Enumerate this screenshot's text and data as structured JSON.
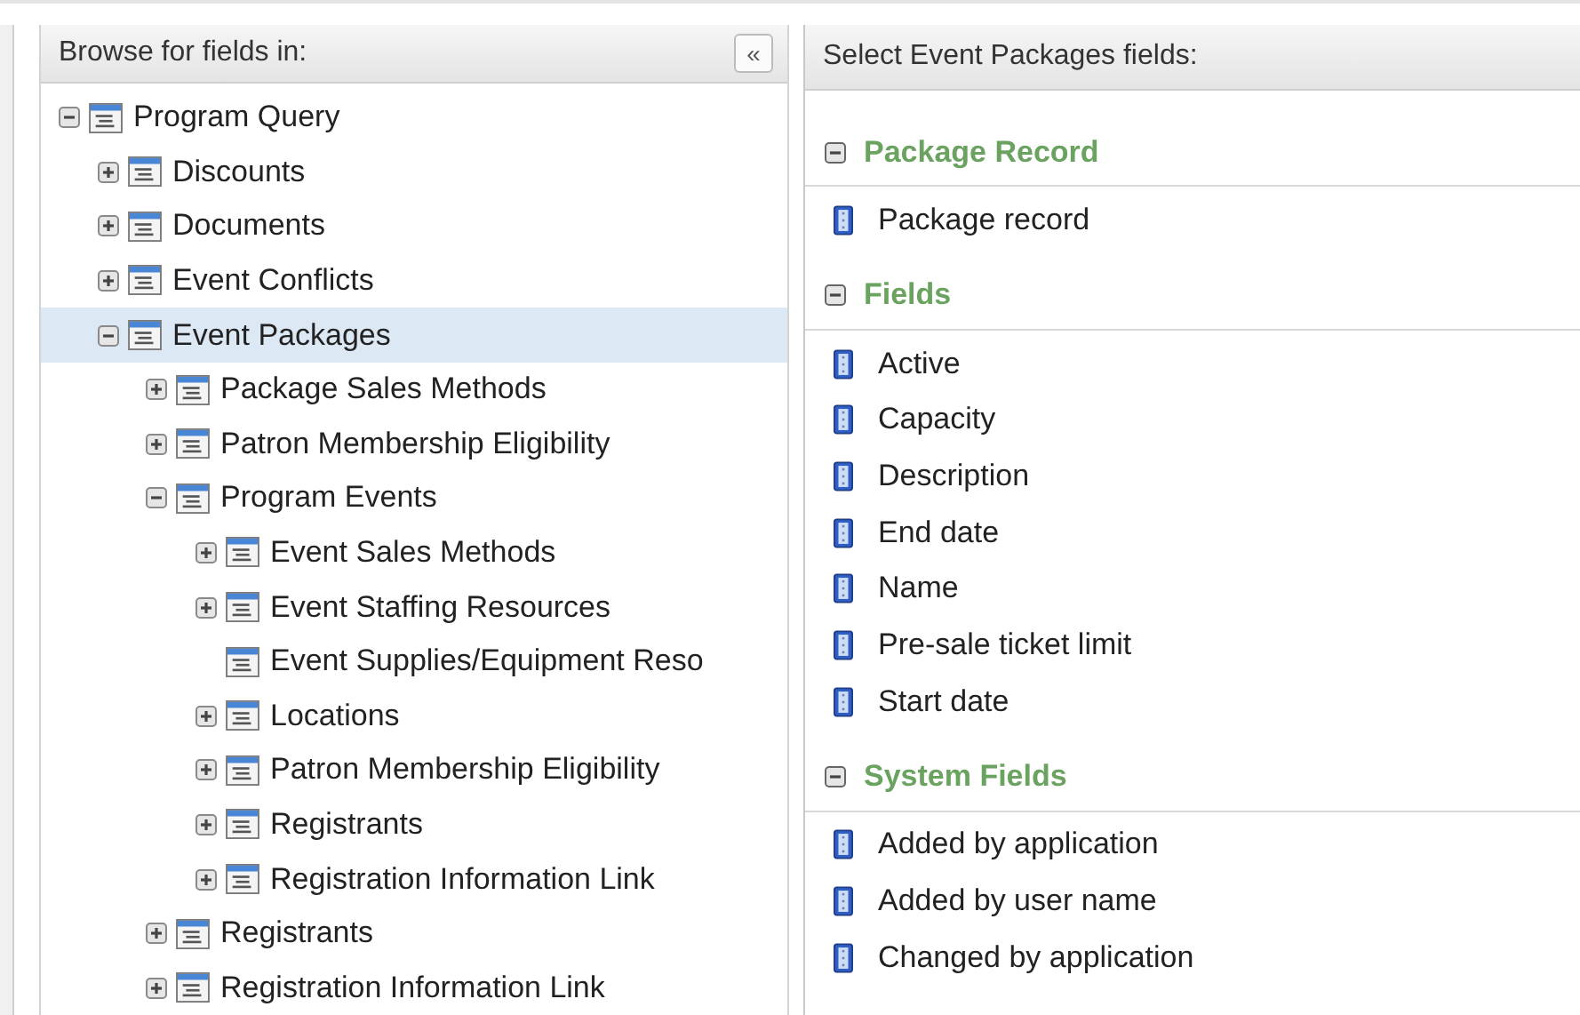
{
  "browse_panel": {
    "title": "Browse for fields in:",
    "collapse_button": "«",
    "tree": [
      {
        "label": "Program Query",
        "kind": "branch",
        "expanded": true,
        "selected": false,
        "children": [
          {
            "label": "Discounts",
            "kind": "branch",
            "expanded": false,
            "selected": false
          },
          {
            "label": "Documents",
            "kind": "branch",
            "expanded": false,
            "selected": false
          },
          {
            "label": "Event Conflicts",
            "kind": "branch",
            "expanded": false,
            "selected": false
          },
          {
            "label": "Event Packages",
            "kind": "branch",
            "expanded": true,
            "selected": true,
            "children": [
              {
                "label": "Package Sales Methods",
                "kind": "branch",
                "expanded": false,
                "selected": false
              },
              {
                "label": "Patron Membership Eligibility",
                "kind": "branch",
                "expanded": false,
                "selected": false
              },
              {
                "label": "Program Events",
                "kind": "branch",
                "expanded": true,
                "selected": false,
                "children": [
                  {
                    "label": "Event Sales Methods",
                    "kind": "branch",
                    "expanded": false,
                    "selected": false
                  },
                  {
                    "label": "Event Staffing Resources",
                    "kind": "branch",
                    "expanded": false,
                    "selected": false
                  },
                  {
                    "label": "Event Supplies/Equipment Reso",
                    "kind": "leaf",
                    "selected": false
                  },
                  {
                    "label": "Locations",
                    "kind": "branch",
                    "expanded": false,
                    "selected": false
                  },
                  {
                    "label": "Patron Membership Eligibility",
                    "kind": "branch",
                    "expanded": false,
                    "selected": false
                  },
                  {
                    "label": "Registrants",
                    "kind": "branch",
                    "expanded": false,
                    "selected": false
                  },
                  {
                    "label": "Registration Information Link",
                    "kind": "branch",
                    "expanded": false,
                    "selected": false
                  }
                ]
              },
              {
                "label": "Registrants",
                "kind": "branch",
                "expanded": false,
                "selected": false
              },
              {
                "label": "Registration Information Link",
                "kind": "branch",
                "expanded": false,
                "selected": false
              }
            ]
          }
        ]
      }
    ]
  },
  "fields_panel": {
    "title": "Select Event Packages fields:",
    "sections": [
      {
        "title": "Package Record",
        "expanded": true,
        "fields": [
          "Package record"
        ]
      },
      {
        "title": "Fields",
        "expanded": true,
        "fields": [
          "Active",
          "Capacity",
          "Description",
          "End date",
          "Name",
          "Pre-sale ticket limit",
          "Start date"
        ]
      },
      {
        "title": "System Fields",
        "expanded": true,
        "fields": [
          "Added by application",
          "Added by user name",
          "Changed by application"
        ]
      }
    ]
  }
}
